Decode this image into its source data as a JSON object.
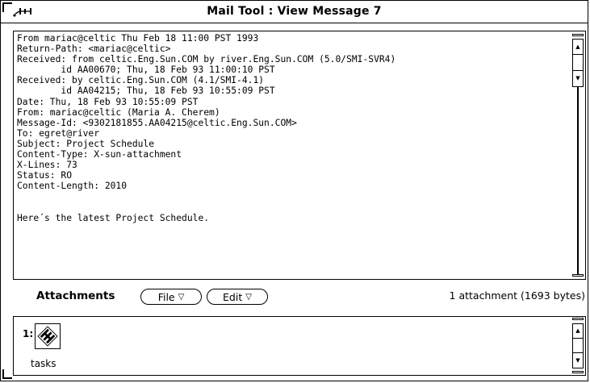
{
  "window": {
    "title": "Mail Tool : View Message 7"
  },
  "message": {
    "lines": [
      "From mariac@celtic Thu Feb 18 11:00 PST 1993",
      "Return-Path: <mariac@celtic>",
      "Received: from celtic.Eng.Sun.COM by river.Eng.Sun.COM (5.0/SMI-SVR4)",
      "        id AA00670; Thu, 18 Feb 93 11:00:10 PST",
      "Received: by celtic.Eng.Sun.COM (4.1/SMI-4.1)",
      "        id AA04215; Thu, 18 Feb 93 10:55:09 PST",
      "Date: Thu, 18 Feb 93 10:55:09 PST",
      "From: mariac@celtic (Maria A. Cherem)",
      "Message-Id: <9302181855.AA04215@celtic.Eng.Sun.COM>",
      "To: egret@river",
      "Subject: Project Schedule",
      "Content-Type: X-sun-attachment",
      "X-Lines: 73",
      "Status: RO",
      "Content-Length: 2010",
      "",
      "",
      "Here´s the latest Project Schedule."
    ]
  },
  "attachments": {
    "label": "Attachments",
    "file_button": "File",
    "edit_button": "Edit",
    "status": "1 attachment (1693 bytes)",
    "items": [
      {
        "number": "1:",
        "name": "tasks",
        "icon": "sun-logo-icon"
      }
    ]
  }
}
